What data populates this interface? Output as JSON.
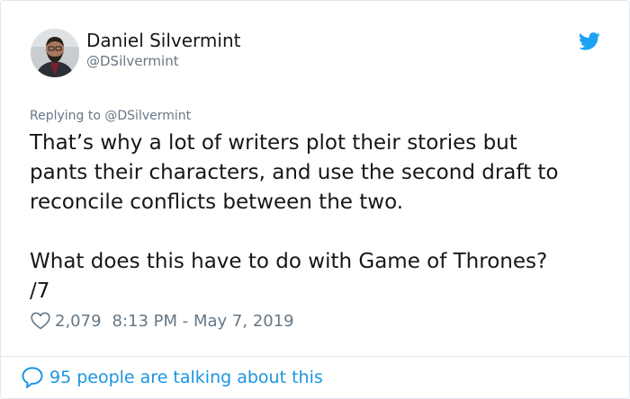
{
  "author": {
    "name": "Daniel Silvermint",
    "handle": "@DSilvermint"
  },
  "tweet": {
    "replying_prefix": "Replying to",
    "replying_to": "@DSilvermint",
    "lines": [
      "That’s why a lot of writers plot their stories but",
      "pants their characters, and use the second draft to",
      "reconcile conflicts between the two."
    ],
    "lines_2": [
      "What does this have to do with Game of Thrones?",
      "/7"
    ]
  },
  "meta": {
    "likes": "2,079",
    "timestamp": "8:13 PM - May 7, 2019"
  },
  "footer": {
    "talking": "95 people are talking about this"
  },
  "icons": {
    "brand": "twitter-bird-icon",
    "like": "heart-icon",
    "conversation": "speech-bubble-icon"
  },
  "colors": {
    "brand_blue": "#1da1f2",
    "link_blue": "#1b95e0",
    "secondary_text": "#657786",
    "primary_text": "#14171a",
    "border": "#e1e8ed"
  }
}
